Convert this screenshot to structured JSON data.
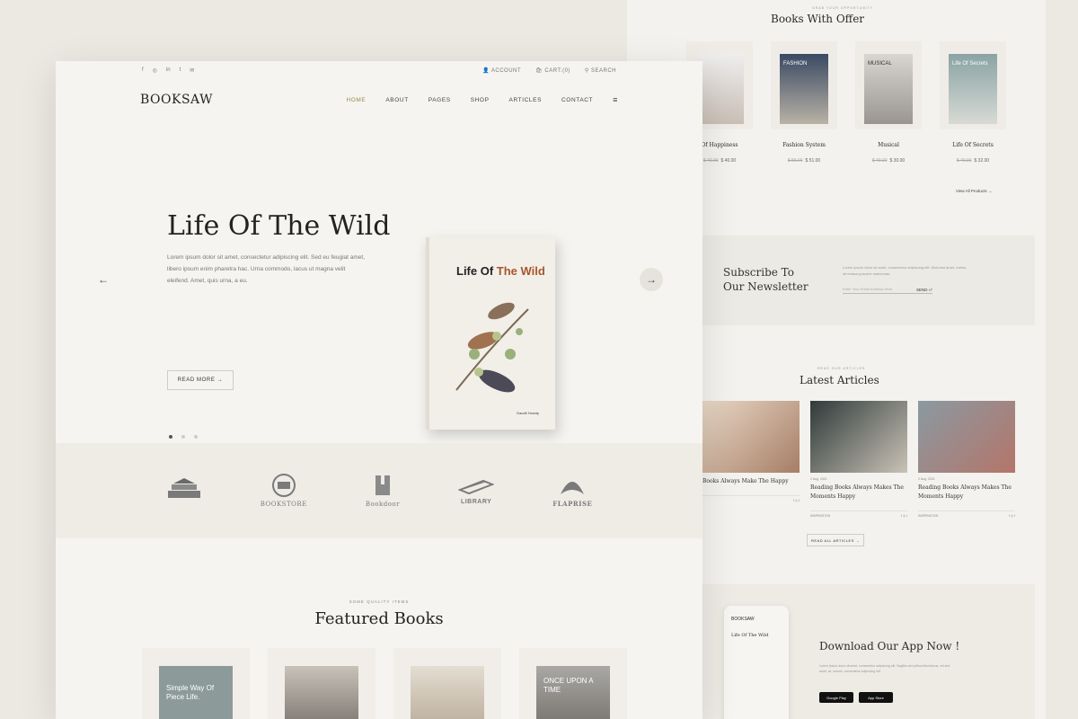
{
  "brand": {
    "name": "BOOKSAW"
  },
  "topbar": {
    "social": [
      "f",
      "◎",
      "in",
      "t",
      "✉"
    ],
    "account": "ACCOUNT",
    "cart": "CART:(0)",
    "search": "SEARCH"
  },
  "nav": {
    "items": [
      "HOME",
      "ABOUT",
      "PAGES",
      "SHOP",
      "ARTICLES",
      "CONTACT"
    ],
    "active": "HOME"
  },
  "hero": {
    "title": "Life Of The Wild",
    "text": "Lorem ipsum dolor sit amet, consectetur adipiscing elit. Sed eu feugiat amet, libero ipsum enim pharetra hac. Urna commodo, lacus ut magna velit eleifend. Amet, quis urna, a eu.",
    "button": "READ MORE →",
    "book": {
      "title_a": "Life Of",
      "title_b": "The Wild",
      "author": "Gaudit Howdy"
    }
  },
  "brands": [
    "",
    "BOOKSTORE",
    "Bookdoor",
    "LIBRARY",
    "FLAPRISE"
  ],
  "featured": {
    "tag": "SOME QUALITY ITEMS",
    "title": "Featured Books",
    "covers": [
      "Simple Way Of Piece Life.",
      "",
      "",
      "ONCE UPON A TIME"
    ]
  },
  "offer": {
    "tag": "GRAB YOUR OPPORTUNITY",
    "title": "Books With Offer",
    "items": [
      {
        "name": "Of Happiness",
        "old": "$ 40.00",
        "price": "$ 40.00"
      },
      {
        "name": "Fashion System",
        "old": "$ 55.00",
        "price": "$ 51.00",
        "cover": "FASHION"
      },
      {
        "name": "Musical",
        "old": "$ 40.00",
        "price": "$ 30.00",
        "cover": "MUSICAL"
      },
      {
        "name": "Life Of Secrets",
        "old": "$ 40.00",
        "price": "$ 32.00",
        "cover": "Life Of Secrets"
      }
    ],
    "view_all": "View All Products →"
  },
  "newsletter": {
    "title_1": "Subscribe To",
    "title_2": "Our Newsletter",
    "text": "Lorem ipsum dolor sit amet, consectetur adipiscing elit. Dictumst amet, metus, sit massa posuere maecenas.",
    "placeholder": "Enter Your Email Address Here",
    "send": "SEND ⏎"
  },
  "articles": {
    "tag": "READ OUR ARTICLES",
    "title": "Latest Articles",
    "items": [
      {
        "date": "",
        "title": "Books Always Make The Happy",
        "cat": ""
      },
      {
        "date": "2 Aug, 2021",
        "title": "Reading Books Always Makes The Moments Happy",
        "cat": "INSPIRATION"
      },
      {
        "date": "2 Aug, 2021",
        "title": "Reading Books Always Makes The Moments Happy",
        "cat": "INSPIRATION"
      }
    ],
    "read_all": "READ ALL ARTICLES →"
  },
  "app": {
    "title": "Download Our App Now !",
    "text": "Lorem ipsum dolor sit amet, consectetur adipiscing elit. Sagittis sed ptibus liberolacus, vel sed amet, sit, mauris, consectetur adipiscing elit.",
    "phone_logo": "BOOKSAW",
    "phone_title": "Life Of The Wild",
    "google": "Google Play",
    "apple": "App Store"
  },
  "colors": {
    "accent": "#a8562c",
    "active": "#9b8a4c"
  }
}
